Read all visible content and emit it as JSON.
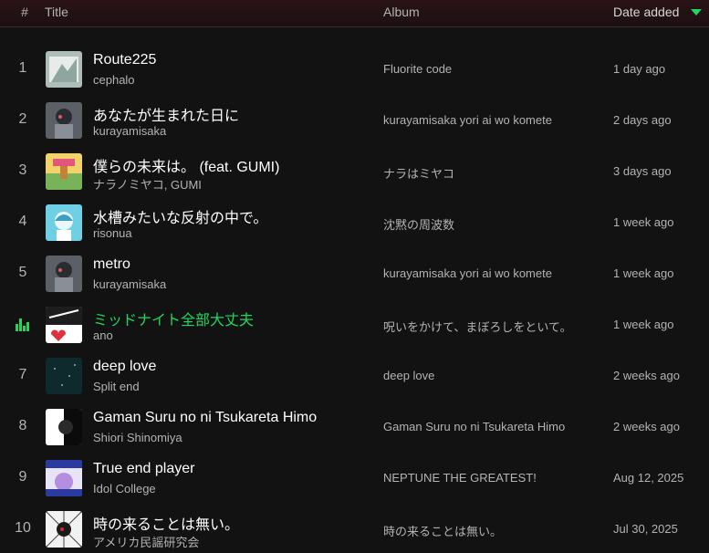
{
  "header": {
    "num_label": "#",
    "title_label": "Title",
    "album_label": "Album",
    "date_label": "Date added",
    "sort_icon": "caret-down-icon",
    "accent_color": "#1ed760"
  },
  "tracks": [
    {
      "num": "1",
      "title": "Route225",
      "artist": "cephalo",
      "album": "Fluorite code",
      "date": "1 day ago",
      "playing": false
    },
    {
      "num": "2",
      "title": "あなたが生まれた日に",
      "artist": "kurayamisaka",
      "album": "kurayamisaka yori ai wo komete",
      "date": "2 days ago",
      "playing": false
    },
    {
      "num": "3",
      "title": "僕らの未来は。 (feat. GUMI)",
      "artist": "ナラノミヤコ, GUMI",
      "album": "ナラはミヤコ",
      "date": "3 days ago",
      "playing": false
    },
    {
      "num": "4",
      "title": "水槽みたいな反射の中で。",
      "artist": "risonua",
      "album": "沈黙の周波数",
      "date": "1 week ago",
      "playing": false
    },
    {
      "num": "5",
      "title": "metro",
      "artist": "kurayamisaka",
      "album": "kurayamisaka yori ai wo komete",
      "date": "1 week ago",
      "playing": false
    },
    {
      "num": "6",
      "title": "ミッドナイト全部大丈夫",
      "artist": "ano",
      "album": "呪いをかけて、まぼろしをといて。",
      "date": "1 week ago",
      "playing": true
    },
    {
      "num": "7",
      "title": "deep love",
      "artist": "Split end",
      "album": "deep love",
      "date": "2 weeks ago",
      "playing": false
    },
    {
      "num": "8",
      "title": "Gaman Suru no ni Tsukareta Himo",
      "artist": "Shiori Shinomiya",
      "album": "Gaman Suru no ni Tsukareta Himo",
      "date": "2 weeks ago",
      "playing": false
    },
    {
      "num": "9",
      "title": "True end player",
      "artist": "Idol College",
      "album": "NEPTUNE THE GREATEST!",
      "date": "Aug 12, 2025",
      "playing": false
    },
    {
      "num": "10",
      "title": "時の来ることは無い。",
      "artist": "アメリカ民謡研究会",
      "album": "時の来ることは無い。",
      "date": "Jul 30, 2025",
      "playing": false
    }
  ]
}
